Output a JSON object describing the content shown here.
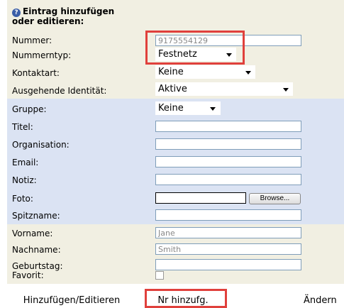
{
  "form": {
    "title_line1": "Eintrag hinzufügen",
    "title_line2": "oder editieren:",
    "help_icon_glyph": "?",
    "fields": {
      "nummer": {
        "label": "Nummer:",
        "value": "9175554129"
      },
      "nummerntyp": {
        "label": "Nummerntyp:",
        "value": "Festnetz"
      },
      "kontaktart": {
        "label": "Kontaktart:",
        "value": "Keine"
      },
      "identitaet": {
        "label": "Ausgehende Identität:",
        "value": "Aktive"
      },
      "gruppe": {
        "label": "Gruppe:",
        "value": "Keine"
      },
      "titel": {
        "label": "Titel:",
        "value": ""
      },
      "organisation": {
        "label": "Organisation:",
        "value": ""
      },
      "email": {
        "label": "Email:",
        "value": ""
      },
      "notiz": {
        "label": "Notiz:",
        "value": ""
      },
      "foto": {
        "label": "Foto:",
        "value": "",
        "browse_label": "Browse..."
      },
      "spitzname": {
        "label": "Spitzname:",
        "value": ""
      },
      "vorname": {
        "label": "Vorname:",
        "value": "Jane"
      },
      "nachname": {
        "label": "Nachname:",
        "value": "Smith"
      },
      "geburtstag": {
        "label": "Geburtstag:",
        "value": ""
      },
      "favorit": {
        "label": "Favorit:",
        "checked": false
      }
    },
    "buttons": {
      "add_edit": "Hinzufügen/Editieren",
      "add_number": "Nr hinzufg.",
      "change": "Ändern"
    }
  },
  "colors": {
    "beige_band": "#f1efe2",
    "blue_band": "#dbe3f3",
    "highlight": "#e0403c",
    "input_border": "#7f9db9"
  }
}
